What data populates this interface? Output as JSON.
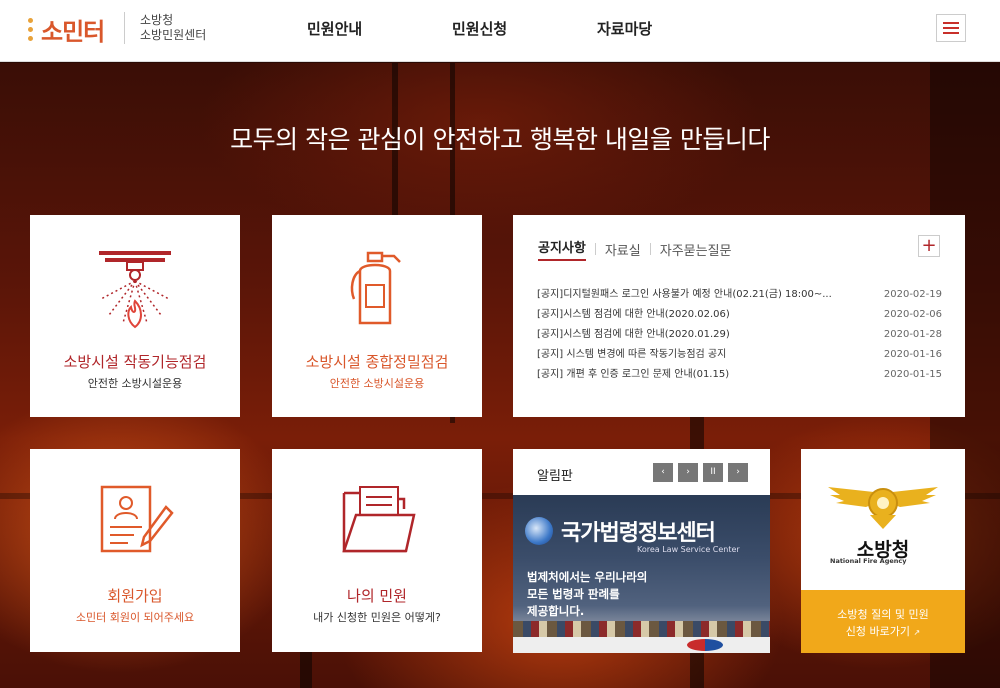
{
  "header": {
    "logo_text": "소민터",
    "org_line1": "소방청",
    "org_line2": "소방민원센터",
    "nav": [
      "민원안내",
      "민원신청",
      "자료마당"
    ],
    "menu_icon": "hamburger-menu-icon"
  },
  "hero": {
    "tagline": "모두의 작은 관심이 안전하고 행복한 내일을 만듭니다"
  },
  "cards": {
    "inspection": {
      "title": "소방시설 작동기능점검",
      "subtitle": "안전한 소방시설운용",
      "icon": "sprinkler-icon"
    },
    "precision": {
      "title": "소방시설 종합정밀점검",
      "subtitle": "안전한 소방시설운용",
      "icon": "fire-extinguisher-icon"
    },
    "signup": {
      "title": "회원가입",
      "subtitle": "소민터 회원이 되어주세요",
      "icon": "profile-document-icon"
    },
    "my_complaints": {
      "title": "나의 민원",
      "subtitle": "내가 신청한 민원은 어떻게?",
      "icon": "folder-icon"
    }
  },
  "notice": {
    "tabs": [
      "공지사항",
      "자료실",
      "자주묻는질문"
    ],
    "more_label": "+",
    "items": [
      {
        "title": "[공지]디지털원패스 로그인 사용불가 예정 안내(02.21(금) 18:00~...",
        "date": "2020-02-19"
      },
      {
        "title": "[공지]시스템 점검에 대한 안내(2020.02.06)",
        "date": "2020-02-06"
      },
      {
        "title": "[공지]시스템 점검에 대한 안내(2020.01.29)",
        "date": "2020-01-28"
      },
      {
        "title": "[공지] 시스템 변경에 따른 작동기능점검 공지",
        "date": "2020-01-16"
      },
      {
        "title": "[공지] 개편 후 인증 로그인 문제 안내(01.15)",
        "date": "2020-01-15"
      }
    ]
  },
  "board": {
    "title": "알림판",
    "controls": [
      "‹",
      "›",
      "II",
      "›"
    ],
    "banner_title": "국가법령정보센터",
    "banner_en": "Korea Law Service Center",
    "banner_line1": "법제처에서는 우리나라의",
    "banner_line2": "모든 법령과 판례를",
    "banner_line3": "제공합니다."
  },
  "agency": {
    "name": "소방청",
    "name_en": "National Fire Agency",
    "cta_line1": "소방청 질의 및 민원",
    "cta_line2": "신청 바로가기"
  },
  "colors": {
    "brand_red": "#b0262a",
    "brand_orange": "#d9572b",
    "cta_yellow": "#f1a81a"
  }
}
